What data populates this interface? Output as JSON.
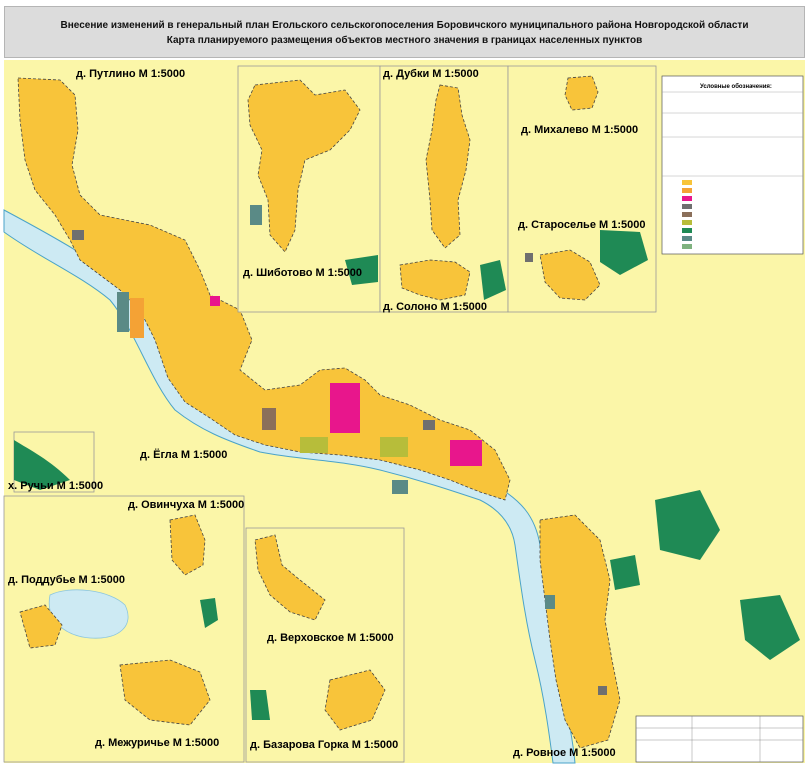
{
  "header": {
    "line1": "Внесение изменений в генеральный план Егольского сельскогопоселения Боровичского муниципального района Новгородской области",
    "line2": "Карта планируемого размещения объектов местного значения в границах населенных пунктов"
  },
  "labels": {
    "putlino": "д. Путлино М 1:5000",
    "shibotovo": "д. Шиботово М 1:5000",
    "dubki": "д. Дубки М 1:5000",
    "solono": "д. Солоно М 1:5000",
    "mikhalevo": "д. Михалево М 1:5000",
    "staroselye": "д. Староселье М 1:5000",
    "egla": "д. Ёгла М 1:5000",
    "ruchyi": "х. Ручьи М 1:5000",
    "ovinchukha": "д. Овинчуха М 1:5000",
    "poddubye": "д. Поддубье М 1:5000",
    "verkhovskoe": "д. Верховское М 1:5000",
    "mezhurichye": "д. Межуричье М 1:5000",
    "bazarova": "д. Базарова Горка М 1:5000",
    "rovnoe": "д. Ровное М 1:5000"
  },
  "legend": {
    "title": "Условные обозначения:"
  },
  "colors": {
    "residential": "#f8c43a",
    "background": "#fbf6a8",
    "water": "#cdeaf3",
    "forest": "#1f8a55",
    "public": "#e8168c",
    "industrial": "#6f6f6f",
    "mixed": "#f4a235",
    "agri": "#b7bd3a",
    "green": "#7fb27f",
    "special": "#5a8a86"
  }
}
